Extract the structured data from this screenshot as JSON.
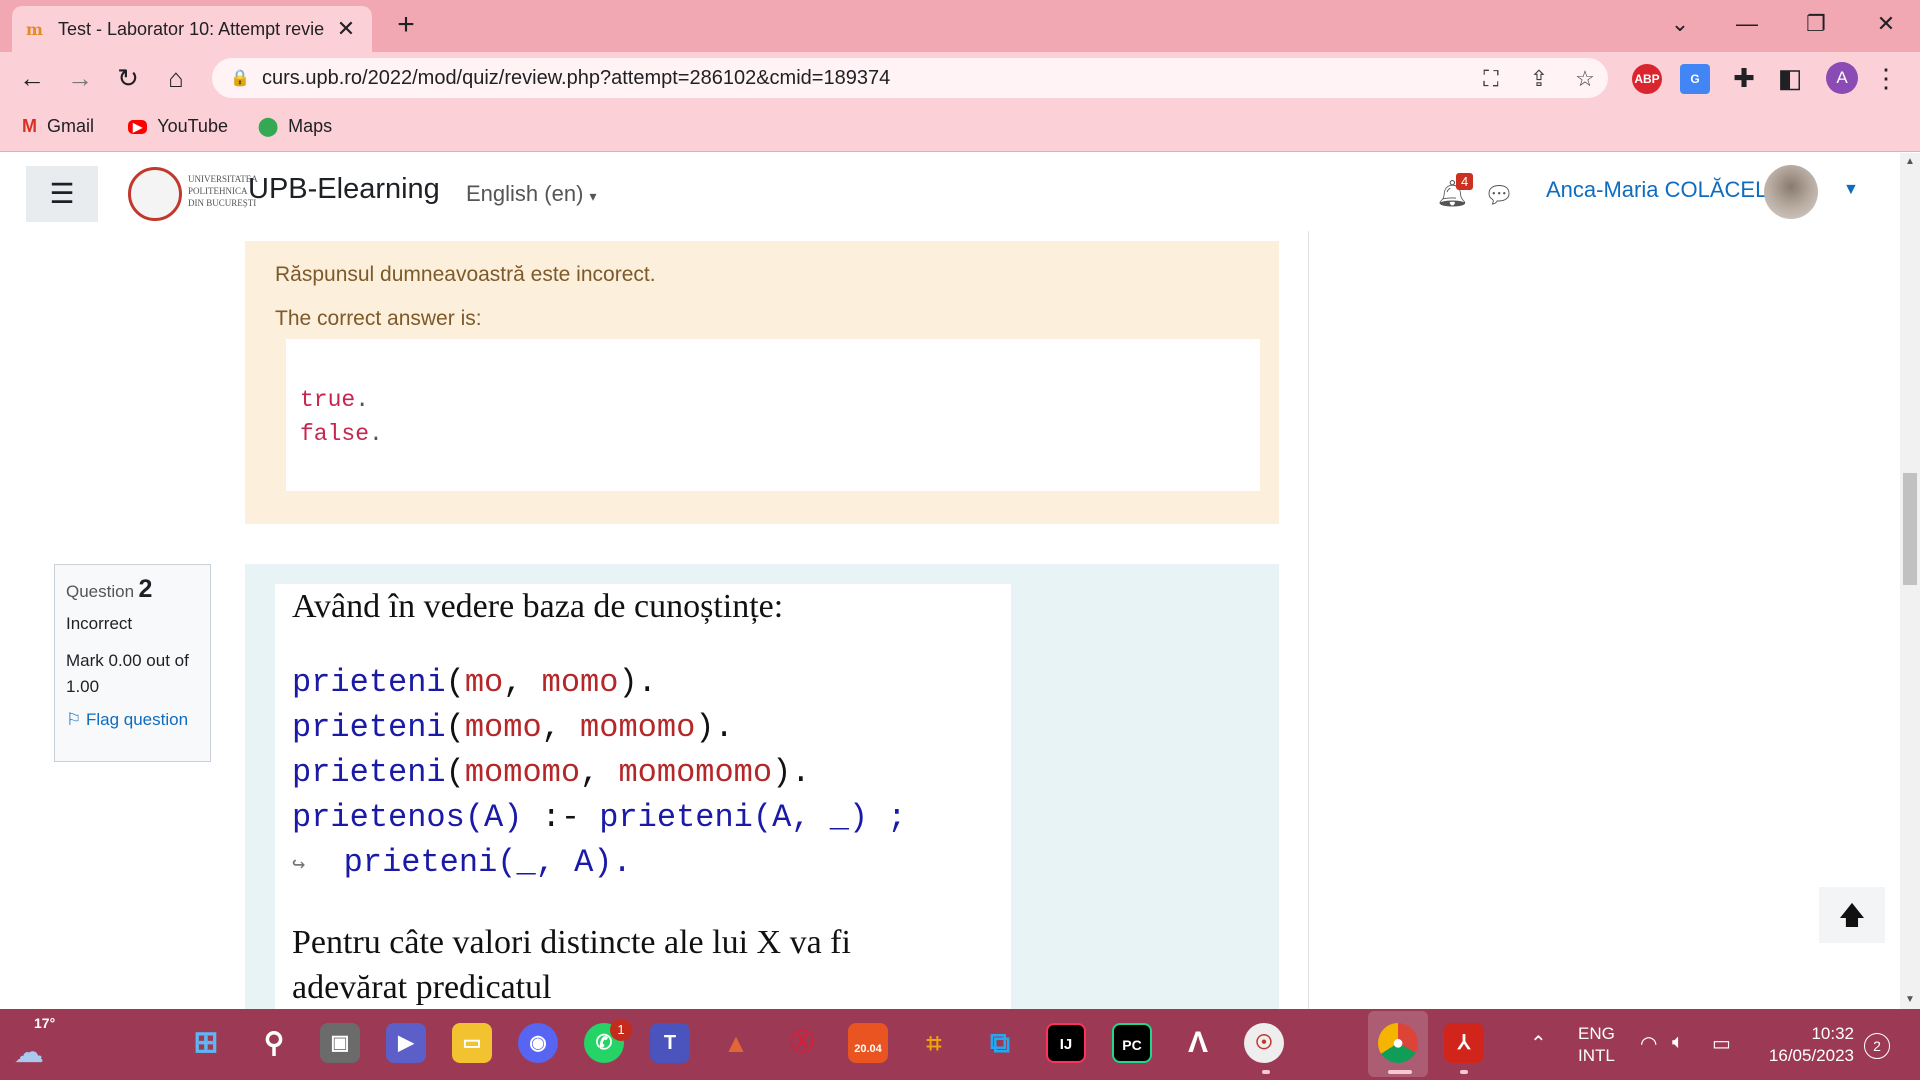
{
  "browser": {
    "tab_title": "Test - Laborator 10: Attempt revie",
    "url": "curs.upb.ro/2022/mod/quiz/review.php?attempt=286102&cmid=189374",
    "bookmarks": [
      {
        "label": "Gmail",
        "icon": "gmail-icon"
      },
      {
        "label": "YouTube",
        "icon": "youtube-icon"
      },
      {
        "label": "Maps",
        "icon": "maps-icon"
      }
    ],
    "extensions": [
      {
        "name": "adblock-plus-icon",
        "label": "ABP",
        "color": "#d9252e"
      },
      {
        "name": "google-translate-ext-icon",
        "label": "G",
        "color": "#4285f4"
      }
    ],
    "profile_initial": "A"
  },
  "navbar": {
    "logo_text_lines": [
      "UNIVERSITATEA",
      "POLITEHNICA",
      "DIN BUCUREȘTI"
    ],
    "site_name": "UPB-Elearning",
    "language": "English (en)",
    "notification_count": "4",
    "user_name": "Anca-Maria COLĂCEL"
  },
  "feedback": {
    "incorrect_text": "Răspunsul dumneavoastră este incorect.",
    "correct_answer_label": "The correct answer is:",
    "answer_lines": [
      "true",
      "false"
    ]
  },
  "question": {
    "label": "Question",
    "number": "2",
    "state": "Incorrect",
    "grade": "Mark 0.00 out of 1.00",
    "flag_label": "Flag question",
    "heading": "Având în vedere baza de cunoștințe:",
    "facts": [
      {
        "pred": "prieteni",
        "a": "mo",
        "b": "momo"
      },
      {
        "pred": "prieteni",
        "a": "momo",
        "b": "momomo"
      },
      {
        "pred": "prieteni",
        "a": "momomo",
        "b": "momomomo"
      }
    ],
    "rule_head": "prietenos(A)",
    "rule_op": ":-",
    "rule_body1": "prieteni(A, _) ;",
    "rule_continuation": "↪",
    "rule_body2": "prieteni(_, A).",
    "paragraph_line1": "Pentru câte valori distincte ale lui X va fi",
    "paragraph_line2": "adevărat predicatul"
  },
  "taskbar": {
    "temperature": "17°",
    "whatsapp_badge": "1",
    "language_top": "ENG",
    "language_bottom": "INTL",
    "time": "10:32",
    "date": "16/05/2023",
    "notification_count": "2",
    "ubuntu_version": "20.04"
  },
  "colors": {
    "tab_bar": "#f2a8b2",
    "toolbar": "#fbd0d6",
    "feedback_bg": "#fcefdc",
    "question_bg": "#e7f3f5",
    "link": "#0f6cbf",
    "taskbar": "#9c3a55"
  }
}
